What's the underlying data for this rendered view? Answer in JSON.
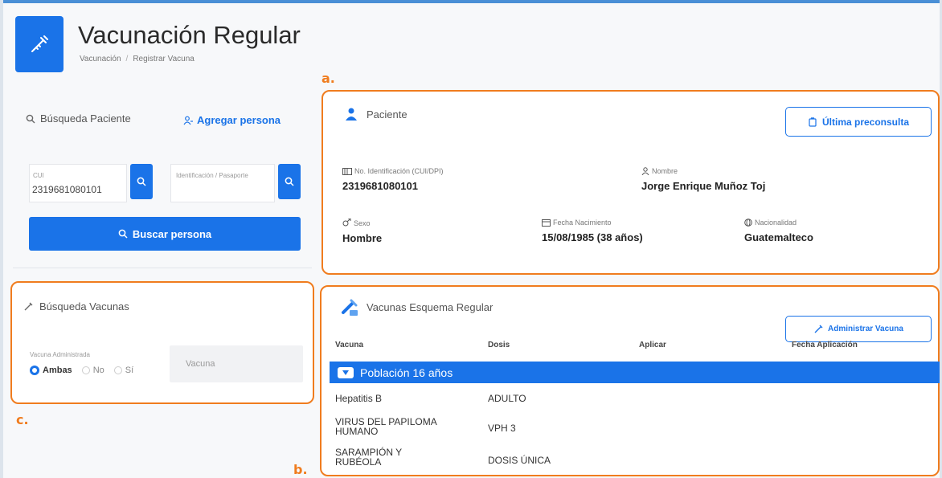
{
  "header": {
    "title": "Vacunación Regular",
    "breadcrumb": [
      "Vacunación",
      "Registrar Vacuna"
    ]
  },
  "annotations": {
    "a": "a.",
    "b": "b.",
    "c": "c."
  },
  "patient_search": {
    "title": "Búsqueda Paciente",
    "add_person": "Agregar persona",
    "cui_label": "CUI",
    "cui_value": "2319681080101",
    "id_label": "Identificación / Pasaporte",
    "search_button": "Buscar persona"
  },
  "vaccine_search": {
    "title": "Búsqueda Vacunas",
    "administered_label": "Vacuna Administrada",
    "options": [
      "Ambas",
      "No",
      "Sí"
    ],
    "selected": "Ambas",
    "vaccine_placeholder": "Vacuna"
  },
  "patient": {
    "title": "Paciente",
    "last_preconsult_button": "Última preconsulta",
    "id_label": "No. Identificación (CUI/DPI)",
    "id_value": "2319681080101",
    "name_label": "Nombre",
    "name_value": "Jorge Enrique Muñoz Toj",
    "sex_label": "Sexo",
    "sex_value": "Hombre",
    "birth_label": "Fecha Nacimiento",
    "birth_value": "15/08/1985 (38 años)",
    "nationality_label": "Nacionalidad",
    "nationality_value": "Guatemalteco"
  },
  "vaccines": {
    "title": "Vacunas Esquema Regular",
    "admin_button": "Administrar Vacuna",
    "columns": [
      "Vacuna",
      "Dosis",
      "Aplicar",
      "Fecha Aplicación"
    ],
    "group": "Población 16 años",
    "rows": [
      {
        "vaccine": "Hepatitis B",
        "dose": "ADULTO"
      },
      {
        "vaccine": "VIRUS DEL PAPILOMA HUMANO",
        "dose": "VPH 3"
      },
      {
        "vaccine": "SARAMPIÓN Y RUBÉOLA",
        "dose": "DOSIS ÚNICA"
      }
    ]
  },
  "colors": {
    "primary": "#1a73e8",
    "annotation": "#f07c1e"
  }
}
